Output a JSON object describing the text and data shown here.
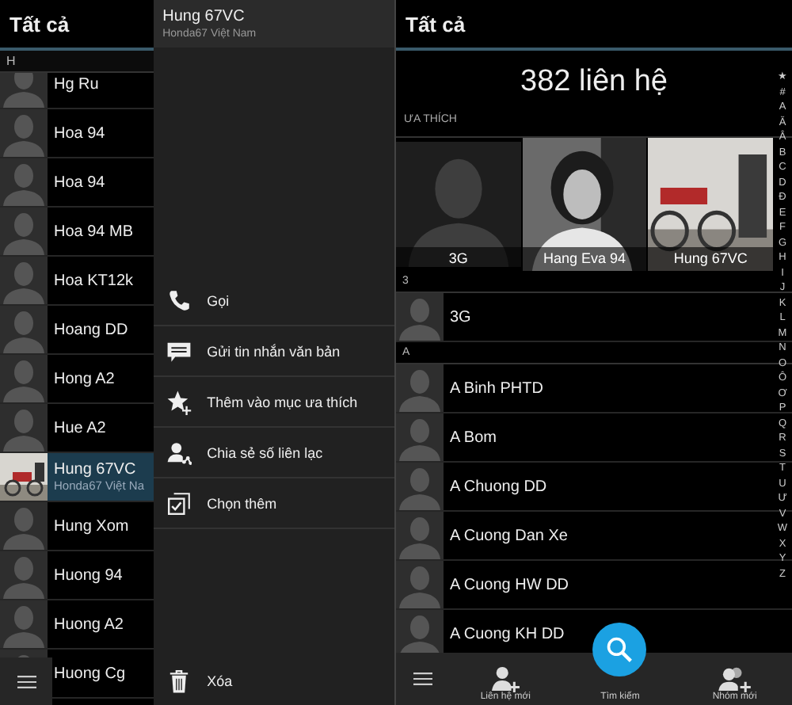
{
  "left_panel": {
    "title": "Tất cả",
    "section": "H",
    "contacts": [
      {
        "name": "Hg Ru",
        "kind": "silhouette",
        "selected": false
      },
      {
        "name": "Hoa 94",
        "kind": "silhouette",
        "selected": false
      },
      {
        "name": "Hoa 94",
        "kind": "silhouette",
        "selected": false
      },
      {
        "name": "Hoa 94 MB",
        "kind": "silhouette",
        "selected": false
      },
      {
        "name": "Hoa KT12k",
        "kind": "silhouette",
        "selected": false
      },
      {
        "name": "Hoang DD",
        "kind": "silhouette",
        "selected": false
      },
      {
        "name": "Hong A2",
        "kind": "silhouette",
        "selected": false
      },
      {
        "name": "Hue A2",
        "kind": "silhouette",
        "selected": false
      },
      {
        "name": "Hung 67VC",
        "subtitle": "Honda67 Việt Na",
        "kind": "picture",
        "selected": true
      },
      {
        "name": "Hung Xom",
        "kind": "silhouette",
        "selected": false
      },
      {
        "name": "Huong 94",
        "kind": "silhouette",
        "selected": false
      },
      {
        "name": "Huong A2",
        "kind": "silhouette",
        "selected": false
      },
      {
        "name": "Huong Cg",
        "kind": "silhouette",
        "selected": false
      }
    ]
  },
  "context_menu": {
    "title": "Hung 67VC",
    "subtitle": "Honda67 Việt Nam",
    "items": [
      {
        "label": "Gọi",
        "kind": "call"
      },
      {
        "label": "Gửi tin nhắn văn bản",
        "kind": "message"
      },
      {
        "label": "Thêm vào mục ưa thích",
        "kind": "favorite"
      },
      {
        "label": "Chia sẻ số liên lạc",
        "kind": "share"
      },
      {
        "label": "Chọn thêm",
        "kind": "select"
      }
    ],
    "delete": "Xóa"
  },
  "right_panel": {
    "title": "Tất cả",
    "count": "382 liên hệ",
    "favorites_heading": "ƯA THÍCH",
    "favorites": [
      {
        "name": "3G",
        "kind": "silhouette"
      },
      {
        "name": "Hang Eva 94",
        "kind": "picture"
      },
      {
        "name": "Hung 67VC",
        "kind": "picture"
      }
    ],
    "sections": [
      {
        "letter": "3",
        "contacts": [
          "3G"
        ]
      },
      {
        "letter": "A",
        "contacts": [
          "A Binh PHTD",
          "A Bom",
          "A Chuong DD",
          "A Cuong Dan Xe",
          "A Cuong HW DD",
          "A Cuong KH DD"
        ]
      }
    ],
    "index": [
      "★",
      "#",
      "A",
      "Ă",
      "Â",
      "B",
      "C",
      "D",
      "Đ",
      "E",
      "F",
      "G",
      "H",
      "I",
      "J",
      "K",
      "L",
      "M",
      "N",
      "O",
      "Ô",
      "Ơ",
      "P",
      "Q",
      "R",
      "S",
      "T",
      "U",
      "Ư",
      "V",
      "W",
      "X",
      "Y",
      "Z"
    ],
    "actions": [
      {
        "label": "Liên hệ mới",
        "kind": "add-contact"
      },
      {
        "label": "Tìm kiếm",
        "kind": "search"
      },
      {
        "label": "Nhóm mới",
        "kind": "add-group"
      }
    ]
  }
}
